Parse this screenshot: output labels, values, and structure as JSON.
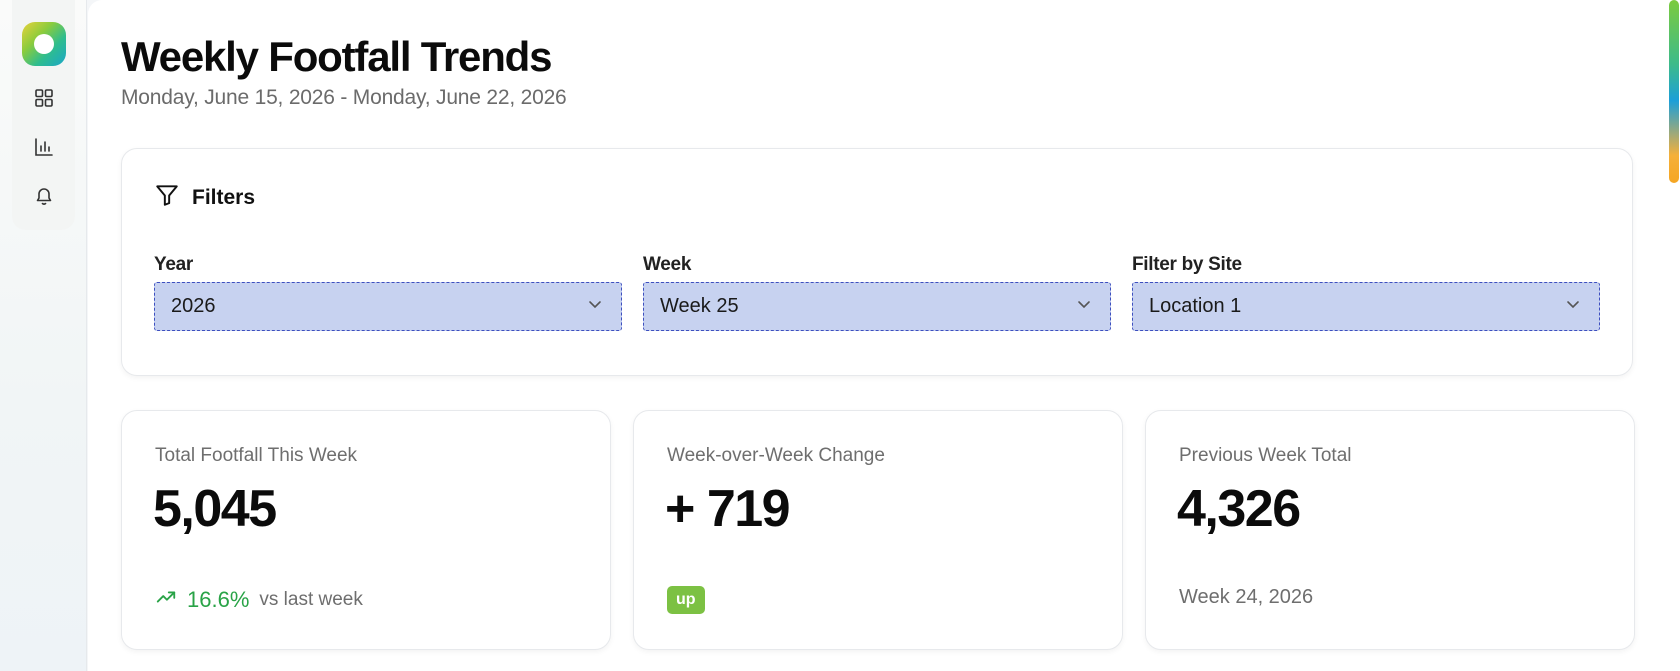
{
  "header": {
    "title": "Weekly Footfall Trends",
    "date_range": "Monday, June 15, 2026 - Monday, June 22, 2026"
  },
  "sidebar": {
    "items": [
      {
        "icon": "grid-icon"
      },
      {
        "icon": "bar-chart-icon"
      },
      {
        "icon": "bell-icon"
      }
    ]
  },
  "filters": {
    "title": "Filters",
    "year": {
      "label": "Year",
      "value": "2026"
    },
    "week": {
      "label": "Week",
      "value": "Week 25"
    },
    "site": {
      "label": "Filter by Site",
      "value": "Location 1"
    }
  },
  "kpis": {
    "total": {
      "label": "Total Footfall This Week",
      "value": "5,045",
      "change_pct": "16.6%",
      "vs_text": "vs last week"
    },
    "wow": {
      "label": "Week-over-Week Change",
      "value": "+ 719",
      "badge": "up"
    },
    "previous": {
      "label": "Previous Week Total",
      "value": "4,326",
      "sub": "Week 24, 2026"
    }
  },
  "colors": {
    "accent_select": "#c7d2f0",
    "positive": "#29a347",
    "badge": "#7cc143"
  }
}
